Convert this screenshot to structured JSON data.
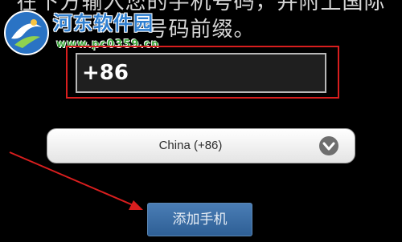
{
  "instruction": {
    "line1": "在下方输入您的手机号码，并附上国际",
    "line2": "号码前缀。"
  },
  "watermark": {
    "site_name": "河东软件园",
    "site_url": "www.pc0359.cn"
  },
  "phone": {
    "value": "+86"
  },
  "country_select": {
    "selected": "China (+86)",
    "icon": "chevron-down-icon"
  },
  "add_phone": {
    "label": "添加手机"
  },
  "colors": {
    "background": "#000000",
    "highlight": "#d81e1e",
    "button": "#3a6ea5",
    "watermark_blue": "#2f7fd0",
    "watermark_green": "#3fa53f"
  }
}
